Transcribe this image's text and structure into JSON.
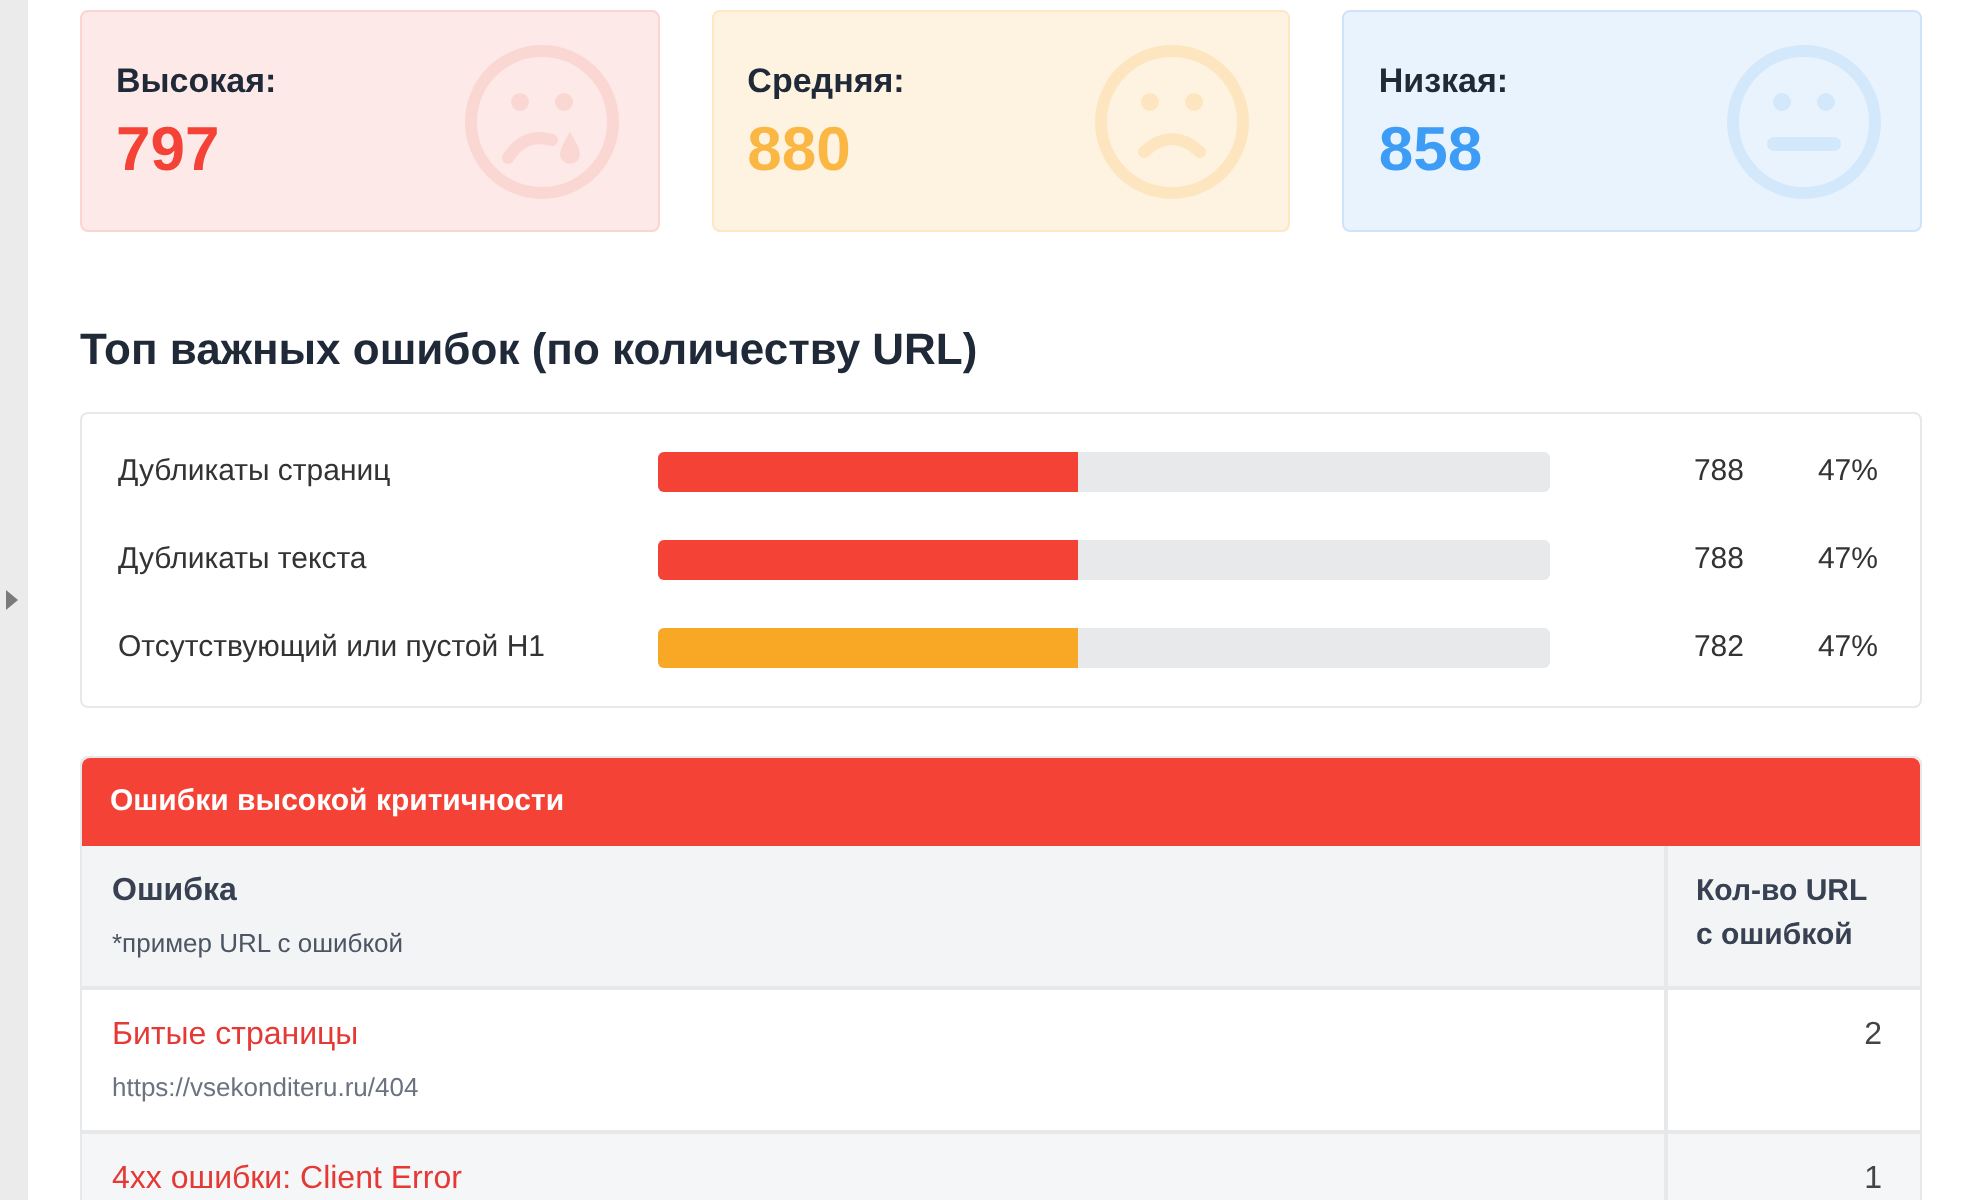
{
  "severity_cards": [
    {
      "kind": "high",
      "label": "Высокая:",
      "count": "797"
    },
    {
      "kind": "medium",
      "label": "Средняя:",
      "count": "880"
    },
    {
      "kind": "low",
      "label": "Низкая:",
      "count": "858"
    }
  ],
  "top_errors": {
    "title": "Топ важных ошибок (по количеству URL)",
    "rows": [
      {
        "label": "Дубликаты страниц",
        "level": 0.47,
        "count": "788",
        "percent": "47%",
        "color": "#f44336"
      },
      {
        "label": "Дубликаты текста",
        "level": 0.47,
        "count": "788",
        "percent": "47%",
        "color": "#f44336"
      },
      {
        "label": "Отсутствующий или пустой H1",
        "level": 0.47,
        "count": "782",
        "percent": "47%",
        "color": "#f9a825"
      }
    ]
  },
  "high_errors_table": {
    "title": "Ошибки высокой критичности",
    "columns": [
      {
        "title": "Ошибка",
        "subtitle": "*пример URL с ошибкой"
      },
      {
        "title": "Кол-во URL с ошибкой"
      }
    ],
    "rows": [
      {
        "error": "Битые страницы",
        "example_url": "https://vsekonditeru.ru/404",
        "count": "2"
      },
      {
        "error": "4xx ошибки: Client Error",
        "count": "1"
      }
    ]
  }
}
